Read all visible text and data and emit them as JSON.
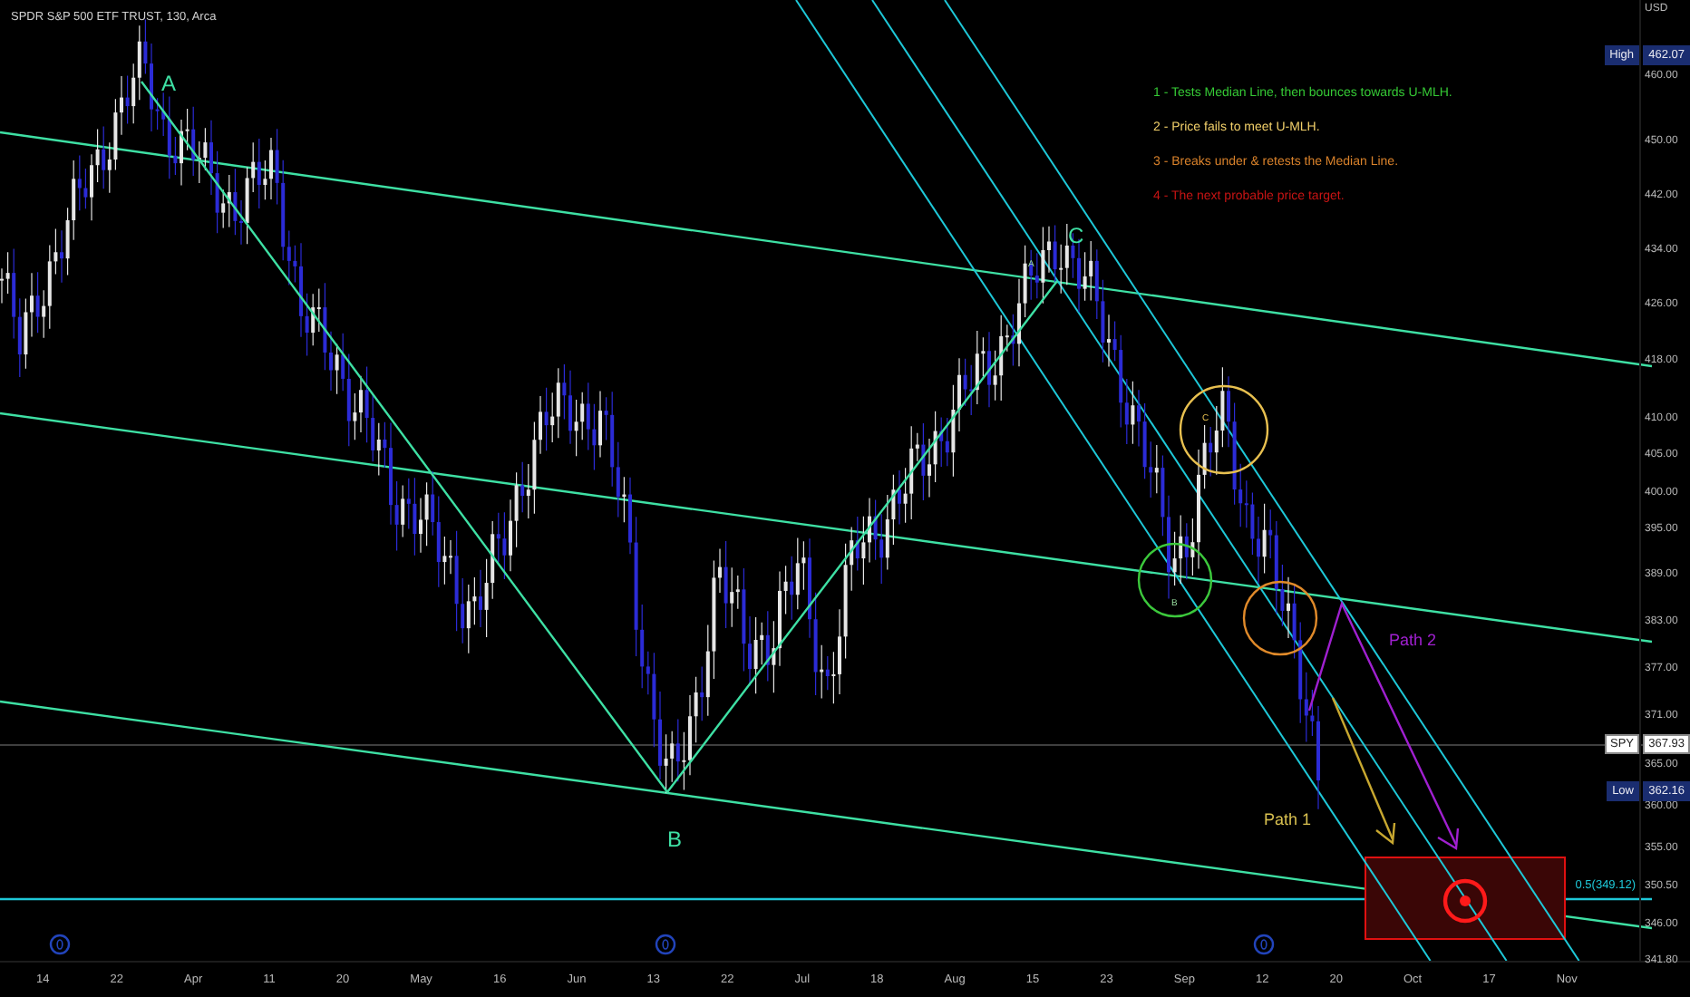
{
  "chart_title": "SPDR S&P 500 ETF TRUST, 130, Arca",
  "legend": [
    {
      "text": "1 - Tests Median Line, then bounces towards U-MLH.",
      "color": "#35c935"
    },
    {
      "text": "2 - Price fails to meet U-MLH.",
      "color": "#f2d06a"
    },
    {
      "text": "3 - Breaks under & retests the Median Line.",
      "color": "#d9822b"
    },
    {
      "text": "4 - The next probable price target.",
      "color": "#c81414"
    }
  ],
  "wave_labels": [
    "A",
    "B",
    "C"
  ],
  "minor_labels": [
    "A",
    "B",
    "C"
  ],
  "path_labels": [
    "Path 1",
    "Path 2"
  ],
  "fib_label": "0.5(349.12)",
  "price_axis": {
    "currency": "USD",
    "ticks": [
      "460.00",
      "450.00",
      "442.00",
      "434.00",
      "426.00",
      "418.00",
      "410.00",
      "405.00",
      "400.00",
      "395.00",
      "389.00",
      "383.00",
      "377.00",
      "371.00",
      "365.00",
      "360.00",
      "355.00",
      "350.50",
      "346.00",
      "341.80"
    ]
  },
  "badges": [
    {
      "kind": "high",
      "label": "High",
      "value": "462.07"
    },
    {
      "kind": "last",
      "label": "SPY",
      "value": "367.93"
    },
    {
      "kind": "low",
      "label": "Low",
      "value": "362.16"
    }
  ],
  "time_axis": {
    "ticks": [
      "14",
      "22",
      "Apr",
      "11",
      "20",
      "May",
      "16",
      "Jun",
      "13",
      "22",
      "Jul",
      "18",
      "Aug",
      "15",
      "23",
      "Sep",
      "12",
      "20",
      "Oct",
      "17",
      "Nov"
    ]
  }
}
